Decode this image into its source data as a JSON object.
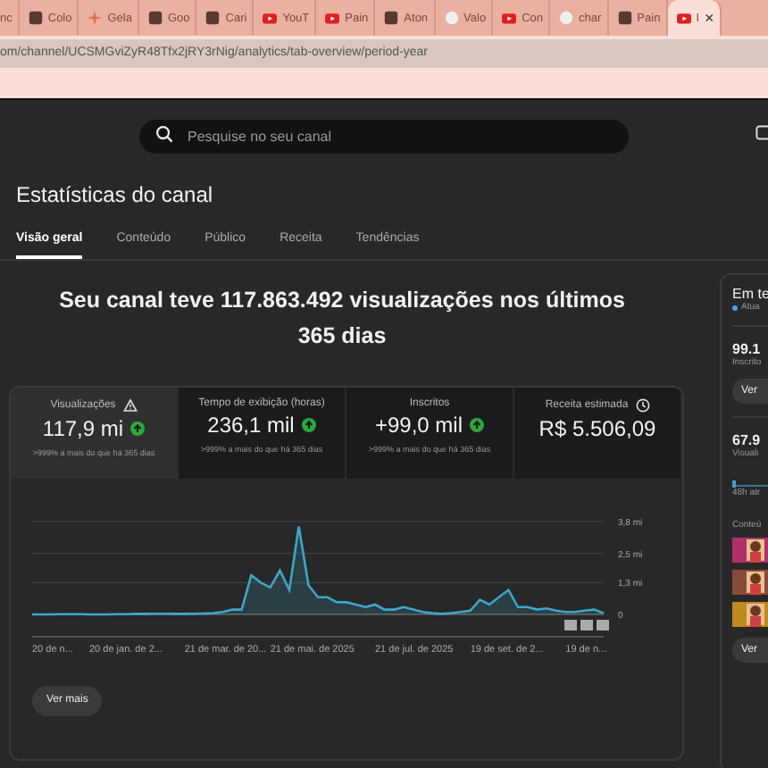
{
  "browser": {
    "tabs": [
      {
        "label": "nc",
        "selected": false
      },
      {
        "label": "Colo",
        "selected": false
      },
      {
        "label": "Gela",
        "selected": false
      },
      {
        "label": "Goo",
        "selected": false
      },
      {
        "label": "Cari",
        "selected": false
      },
      {
        "label": "YouT",
        "selected": false
      },
      {
        "label": "Pain",
        "selected": false
      },
      {
        "label": "Aton",
        "selected": false
      },
      {
        "label": "Valo",
        "selected": false
      },
      {
        "label": "Con",
        "selected": false
      },
      {
        "label": "char",
        "selected": false
      },
      {
        "label": "Pain",
        "selected": false
      },
      {
        "label": "I",
        "selected": true
      }
    ],
    "close": "×",
    "url": "om/channel/UCSMGviZyR48Tfx2jRY3rNig/analytics/tab-overview/period-year"
  },
  "search": {
    "placeholder": "Pesquise no seu canal"
  },
  "page_title": "Estatísticas do canal",
  "tabs": [
    {
      "label": "Visão geral",
      "selected": true
    },
    {
      "label": "Conteúdo",
      "selected": false
    },
    {
      "label": "Público",
      "selected": false
    },
    {
      "label": "Receita",
      "selected": false
    },
    {
      "label": "Tendências",
      "selected": false
    }
  ],
  "headline": "Seu canal teve 117.863.492 visualizações nos últimos 365 dias",
  "metrics": [
    {
      "label": "Visualizações",
      "kind": "growth",
      "value": "117,9 mi",
      "note": ">999% a mais do que há 365 dias",
      "selected": true
    },
    {
      "label": "Tempo de exibição (horas)",
      "kind": "growth",
      "value": "236,1 mil",
      "note": ">999% a mais do que há 365 dias",
      "selected": false
    },
    {
      "label": "Inscritos",
      "kind": "growth",
      "value": "+99,0 mil",
      "note": ">999% a mais do que há 365 dias",
      "selected": false
    },
    {
      "label": "Receita estimada",
      "kind": "plain",
      "value": "R$ 5.506,09",
      "selected": false
    }
  ],
  "chart_data": {
    "type": "area",
    "ylim": [
      0,
      3.8
    ],
    "yticks": [
      {
        "value": 0,
        "label": "0"
      },
      {
        "value": 1.3,
        "label": "1,3 mi"
      },
      {
        "value": 2.5,
        "label": "2,5 mi"
      },
      {
        "value": 3.8,
        "label": "3,8 mi"
      }
    ],
    "series": [
      {
        "color": "#3ea6c9",
        "values": [
          0,
          0,
          0,
          0.01,
          0.01,
          0.01,
          0,
          0,
          0,
          0.01,
          0.01,
          0.02,
          0.02,
          0.03,
          0.03,
          0.02,
          0.02,
          0.03,
          0.04,
          0.05,
          0.1,
          0.2,
          0.2,
          1.6,
          1.3,
          1.1,
          1.8,
          1.0,
          3.6,
          1.2,
          0.7,
          0.7,
          0.5,
          0.5,
          0.4,
          0.3,
          0.4,
          0.2,
          0.2,
          0.3,
          0.2,
          0.1,
          0.05,
          0.02,
          0.05,
          0.1,
          0.15,
          0.6,
          0.4,
          0.7,
          1.0,
          0.3,
          0.3,
          0.2,
          0.25,
          0.15,
          0.1,
          0.1,
          0.15,
          0.2,
          0.05
        ]
      }
    ]
  },
  "x_axis_labels": [
    "20 de n...",
    "20 de jan. de 2...",
    "21 de mar. de 20...",
    "21 de mai. de 2025",
    "21 de jul. de 2025",
    "19 de set. de 2...",
    "19 de n..."
  ],
  "see_more": "Ver mais",
  "realtime": {
    "title": "Em te",
    "live": "Atua",
    "subs_value": "99.1",
    "subs_label": "Inscrito",
    "button": "Ver",
    "views_value": "67.9",
    "views_label": "Visuali",
    "window": "48h atr",
    "content_label": "Conteú",
    "button_bottom": "Ver"
  }
}
